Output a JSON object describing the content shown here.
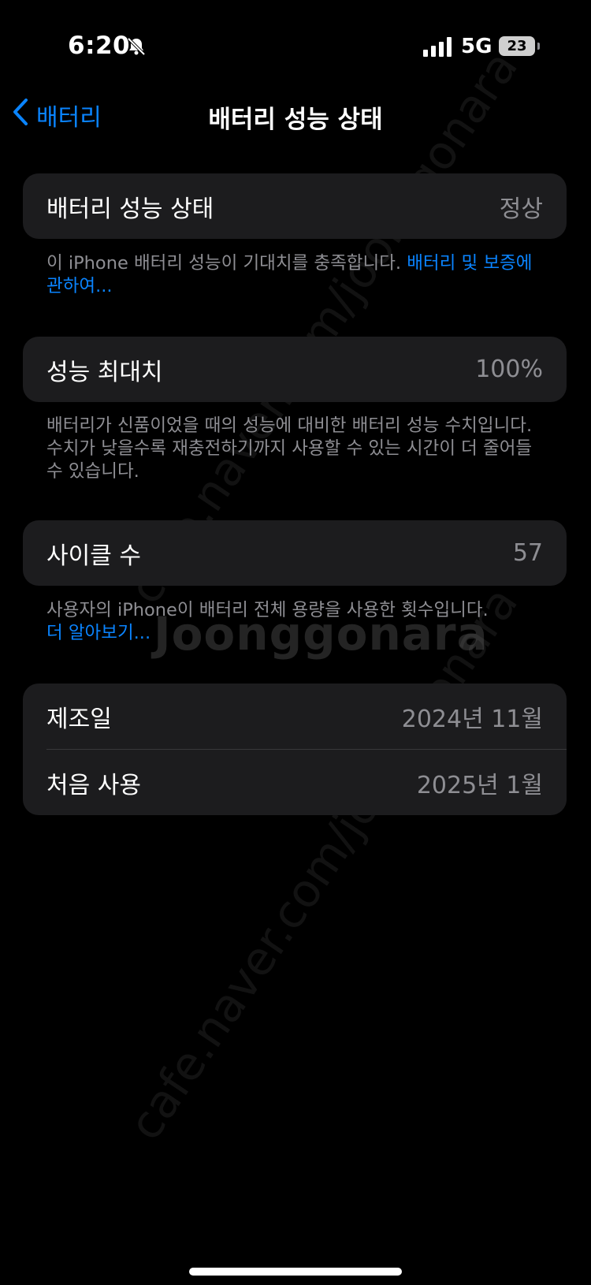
{
  "status_bar": {
    "time": "6:20",
    "network": "5G",
    "battery": "23"
  },
  "nav": {
    "back_label": "배터리",
    "title": "배터리 성능 상태"
  },
  "health": {
    "label": "배터리 성능 상태",
    "value": "정상",
    "note_text": "이 iPhone 배터리 성능이 기대치를 충족합니다. ",
    "note_link": "배터리 및 보증에 관하여..."
  },
  "capacity": {
    "label": "성능 최대치",
    "value": "100%",
    "note": "배터리가 신품이었을 때의 성능에 대비한 배터리 성능 수치입니다. 수치가 낮을수록 재충전하기까지 사용할 수 있는 시간이 더 줄어들 수 있습니다."
  },
  "cycles": {
    "label": "사이클 수",
    "value": "57",
    "note_text": "사용자의 iPhone이 배터리 전체 용량을 사용한 횟수입니다.",
    "note_link": "더 알아보기..."
  },
  "dates": {
    "manufacture_label": "제조일",
    "manufacture_value": "2024년 11월",
    "first_use_label": "처음 사용",
    "first_use_value": "2025년 1월"
  },
  "watermark": {
    "url": "cafe.naver.com/joonggonara",
    "logo": "Joonggonara"
  },
  "colors": {
    "accent": "#0a84ff",
    "card": "#1c1c1e",
    "secondary_text": "#8e8e93"
  }
}
